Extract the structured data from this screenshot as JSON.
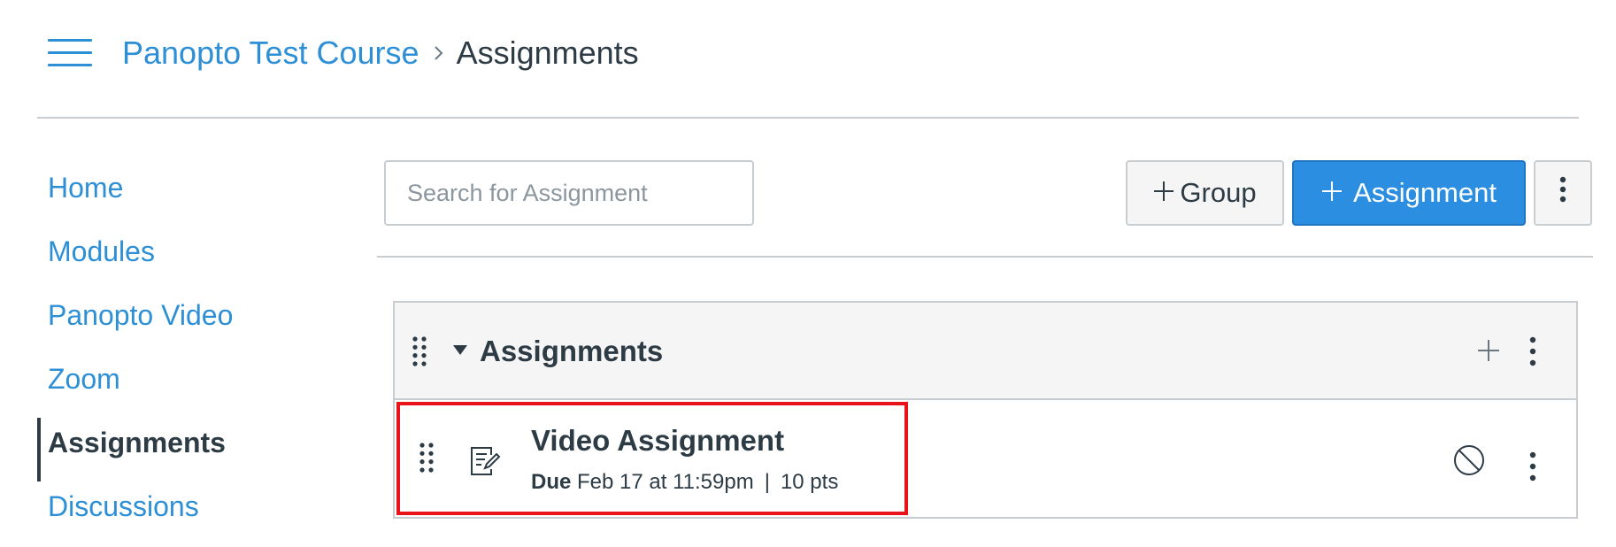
{
  "header": {
    "breadcrumb_course": "Panopto Test Course",
    "breadcrumb_current": "Assignments"
  },
  "sidebar": {
    "items": [
      {
        "label": "Home"
      },
      {
        "label": "Modules"
      },
      {
        "label": "Panopto Video"
      },
      {
        "label": "Zoom"
      },
      {
        "label": "Assignments",
        "active": true
      },
      {
        "label": "Discussions"
      }
    ]
  },
  "toolbar": {
    "search_placeholder": "Search for Assignment",
    "group_button": "Group",
    "assignment_button": "Assignment"
  },
  "assignment_group": {
    "title": "Assignments",
    "assignments": [
      {
        "title": "Video Assignment",
        "due_label": "Due",
        "due_date": "Feb 17 at 11:59pm",
        "points": "10 pts"
      }
    ]
  },
  "colors": {
    "link": "#2d8fd6",
    "primary_button": "#2b8ee0",
    "text": "#2d3b45",
    "highlight": "#e8141a"
  },
  "icons": [
    "hamburger-icon",
    "chevron-right-icon",
    "plus-icon",
    "kebab-icon",
    "drag-handle-icon",
    "caret-down-icon",
    "assignment-icon",
    "unpublished-icon"
  ]
}
